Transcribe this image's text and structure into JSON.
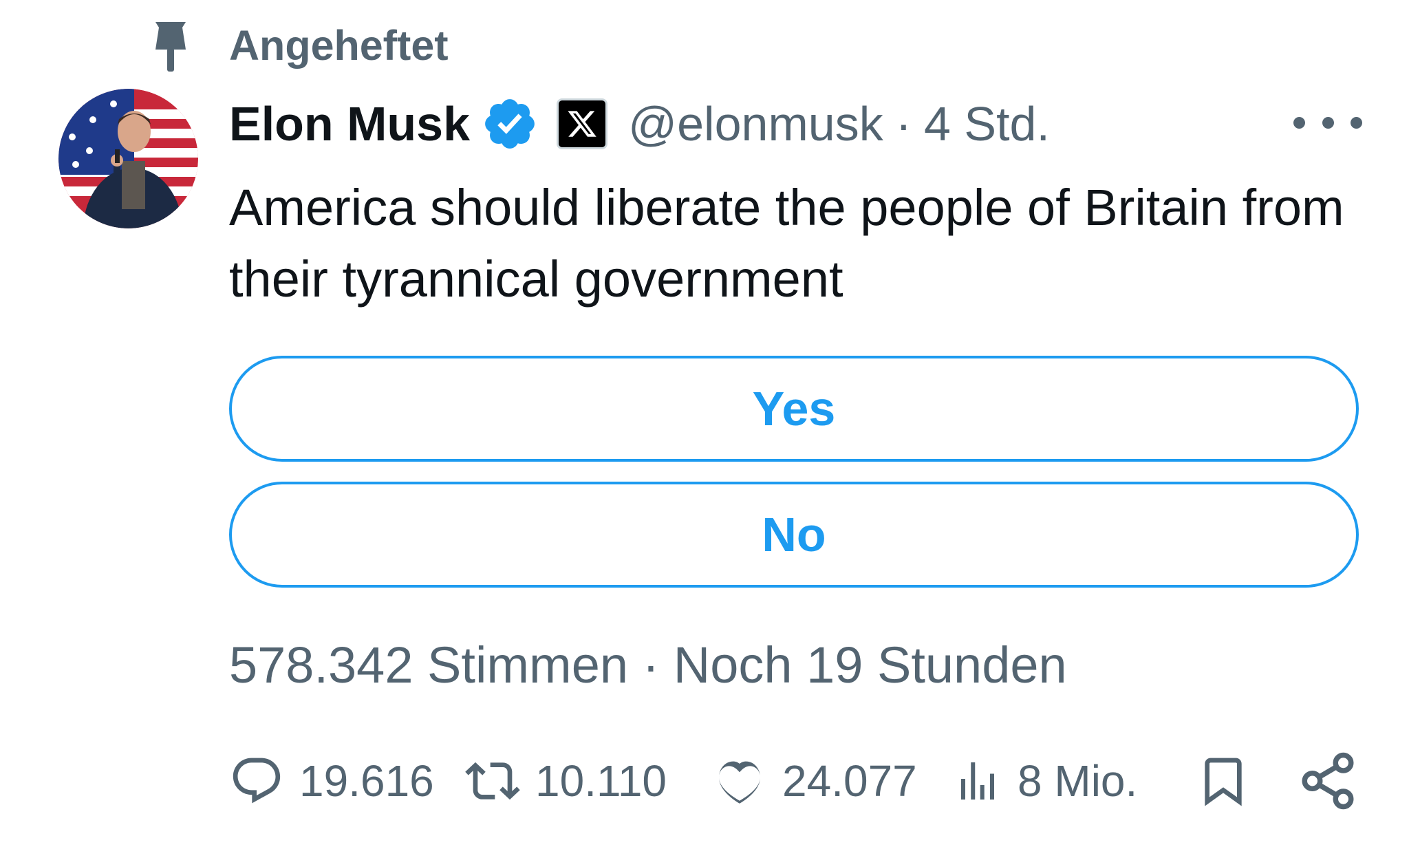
{
  "pinned": {
    "label": "Angeheftet",
    "icon": "pin-icon"
  },
  "author": {
    "name": "Elon Musk",
    "verified_icon": "verified-badge-icon",
    "affiliation_icon": "x-logo-icon",
    "handle": "@elonmusk",
    "separator": "·",
    "time": "4 Std."
  },
  "tweet": {
    "text": "America should liberate the people of Britain from their tyrannical government"
  },
  "poll": {
    "options": [
      {
        "label": "Yes"
      },
      {
        "label": "No"
      }
    ],
    "votes": "578.342 Stimmen",
    "separator": "·",
    "remaining": "Noch 19 Stunden"
  },
  "actions": {
    "replies": "19.616",
    "retweets": "10.110",
    "likes": "24.077",
    "views": "8 Mio."
  },
  "colors": {
    "accent": "#1d9bf0",
    "secondary_text": "#536471",
    "primary_text": "#0f1419"
  }
}
